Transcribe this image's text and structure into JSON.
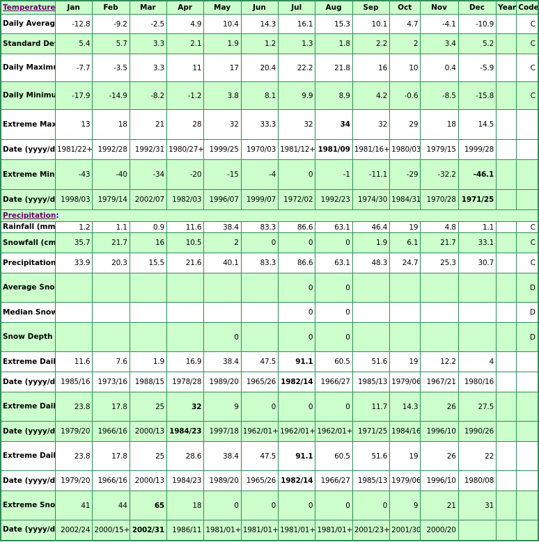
{
  "header": {
    "temperature_label": "Temperature",
    "months": [
      "Jan",
      "Feb",
      "Mar",
      "Apr",
      "May",
      "Jun",
      "Jul",
      "Aug",
      "Sep",
      "Oct",
      "Nov",
      "Dec"
    ],
    "year_label": "Year",
    "code_label": "Code"
  },
  "precipitation_label": "Precipitation",
  "colon": ":",
  "temperature_rows": [
    {
      "label": "Daily Average (°C)",
      "style": "white",
      "values": [
        "-12.8",
        "-9.2",
        "-2.5",
        "4.9",
        "10.4",
        "14.3",
        "16.1",
        "15.3",
        "10.1",
        "4.7",
        "-4.1",
        "-10.9"
      ],
      "year": "",
      "code": "C"
    },
    {
      "label": "Standard Deviation",
      "style": "green",
      "values": [
        "5.4",
        "5.7",
        "3.3",
        "2.1",
        "1.9",
        "1.2",
        "1.3",
        "1.8",
        "2.2",
        "2",
        "3.4",
        "5.2"
      ],
      "year": "",
      "code": "C"
    },
    {
      "label": "Daily Maximum (°C)",
      "style": "white",
      "values": [
        "-7.7",
        "-3.5",
        "3.3",
        "11",
        "17",
        "20.4",
        "22.2",
        "21.8",
        "16",
        "10",
        "0.4",
        "-5.9"
      ],
      "year": "",
      "code": "C"
    },
    {
      "label": "Daily Minimum (°C)",
      "style": "green",
      "values": [
        "-17.9",
        "-14.9",
        "-8.2",
        "-1.2",
        "3.8",
        "8.1",
        "9.9",
        "8.9",
        "4.2",
        "-0.6",
        "-8.5",
        "-15.8"
      ],
      "year": "",
      "code": "C"
    },
    {
      "label": "Extreme Maximum (°C)",
      "style": "white",
      "group_top": true,
      "values": [
        "13",
        "18",
        "21",
        "28",
        "32",
        "33.3",
        "32",
        "34",
        "32",
        "29",
        "18",
        "14.5"
      ],
      "bold_index": 7,
      "year": "",
      "code": ""
    },
    {
      "label": "Date (yyyy/dd)",
      "style": "white",
      "values": [
        "1981/22+",
        "1992/28",
        "1992/31",
        "1980/27+",
        "1999/25",
        "1970/03",
        "1981/12+",
        "1981/09",
        "1981/16+",
        "1980/03",
        "1979/15",
        "1999/28"
      ],
      "bold_index": 7,
      "year": "",
      "code": ""
    },
    {
      "label": "Extreme Minimum (°C)",
      "style": "green",
      "values": [
        "-43",
        "-40",
        "-34",
        "-20",
        "-15",
        "-4",
        "0",
        "-1",
        "-11.1",
        "-29",
        "-32.2",
        "-46.1"
      ],
      "bold_index": 11,
      "year": "",
      "code": ""
    },
    {
      "label": "Date (yyyy/dd)",
      "style": "green",
      "values": [
        "1998/03",
        "1979/14",
        "2002/07",
        "1982/03",
        "1996/07",
        "1999/07",
        "1972/02",
        "1992/23",
        "1974/30",
        "1984/31",
        "1970/28",
        "1971/25"
      ],
      "bold_index": 11,
      "year": "",
      "code": ""
    }
  ],
  "precipitation_rows": [
    {
      "label": "Rainfall (mm)",
      "style": "white",
      "values": [
        "1.2",
        "1.1",
        "0.9",
        "11.6",
        "38.4",
        "83.3",
        "86.6",
        "63.1",
        "46.4",
        "19",
        "4.8",
        "1.1"
      ],
      "year": "",
      "code": "C"
    },
    {
      "label": "Snowfall (cm)",
      "style": "green",
      "values": [
        "35.7",
        "21.7",
        "16",
        "10.5",
        "2",
        "0",
        "0",
        "0",
        "1.9",
        "6.1",
        "21.7",
        "33.1"
      ],
      "year": "",
      "code": "C"
    },
    {
      "label": "Precipitation (mm)",
      "style": "white",
      "values": [
        "33.9",
        "20.3",
        "15.5",
        "21.6",
        "40.1",
        "83.3",
        "86.6",
        "63.1",
        "48.3",
        "24.7",
        "25.3",
        "30.7"
      ],
      "year": "",
      "code": "C"
    },
    {
      "label": "Average Snow Depth (cm)",
      "style": "green",
      "values": [
        "",
        "",
        "",
        "",
        "",
        "",
        "0",
        "0",
        "",
        "",
        "",
        ""
      ],
      "year": "",
      "code": "D"
    },
    {
      "label": "Median Snow Depth (cm)",
      "style": "white",
      "values": [
        "",
        "",
        "",
        "",
        "",
        "",
        "0",
        "0",
        "",
        "",
        "",
        ""
      ],
      "year": "",
      "code": "D"
    },
    {
      "label": "Snow Depth at Month-end (cm)",
      "style": "green",
      "values": [
        "",
        "",
        "",
        "",
        "0",
        "",
        "0",
        "0",
        "",
        "",
        "",
        ""
      ],
      "year": "",
      "code": "D"
    },
    {
      "label": "Extreme Daily Rainfall (mm)",
      "style": "white",
      "group_top": true,
      "values": [
        "11.6",
        "7.6",
        "1.9",
        "16.9",
        "38.4",
        "47.5",
        "91.1",
        "60.5",
        "51.6",
        "19",
        "12.2",
        "4"
      ],
      "bold_index": 6,
      "year": "",
      "code": ""
    },
    {
      "label": "Date (yyyy/dd)",
      "style": "white",
      "values": [
        "1985/16",
        "1973/16",
        "1988/15",
        "1978/28",
        "1989/20",
        "1965/26",
        "1982/14",
        "1966/27",
        "1985/13",
        "1979/06",
        "1967/21",
        "1980/16"
      ],
      "bold_index": 6,
      "year": "",
      "code": ""
    },
    {
      "label": "Extreme Daily Snowfall (cm)",
      "style": "green",
      "values": [
        "23.8",
        "17.8",
        "25",
        "32",
        "9",
        "0",
        "0",
        "0",
        "11.7",
        "14.3",
        "26",
        "27.5"
      ],
      "bold_index": 3,
      "year": "",
      "code": ""
    },
    {
      "label": "Date (yyyy/dd)",
      "style": "green",
      "values": [
        "1979/20",
        "1966/16",
        "2000/13",
        "1984/23",
        "1997/18",
        "1962/01+",
        "1962/01+",
        "1962/01+",
        "1971/25",
        "1984/16",
        "1996/10",
        "1990/26"
      ],
      "bold_index": 3,
      "year": "",
      "code": ""
    },
    {
      "label": "Extreme Daily Precipitation (mm)",
      "style": "white",
      "values": [
        "23.8",
        "17.8",
        "25",
        "28.6",
        "38.4",
        "47.5",
        "91.1",
        "60.5",
        "51.6",
        "19",
        "26",
        "22"
      ],
      "bold_index": 6,
      "year": "",
      "code": ""
    },
    {
      "label": "Date (yyyy/dd)",
      "style": "white",
      "values": [
        "1979/20",
        "1966/16",
        "2000/13",
        "1984/23",
        "1989/20",
        "1965/26",
        "1982/14",
        "1966/27",
        "1985/13",
        "1979/06",
        "1996/10",
        "1980/08"
      ],
      "bold_index": 6,
      "year": "",
      "code": ""
    },
    {
      "label": "Extreme Snow Depth (cm)",
      "style": "green",
      "values": [
        "41",
        "44",
        "65",
        "18",
        "0",
        "0",
        "0",
        "0",
        "0",
        "9",
        "21",
        "31"
      ],
      "bold_index": 2,
      "year": "",
      "code": ""
    },
    {
      "label": "Date (yyyy/dd)",
      "style": "green",
      "values": [
        "2002/24",
        "2000/15+",
        "2002/31",
        "1986/11",
        "1981/01+",
        "1981/01+",
        "1981/01+",
        "1981/01+",
        "2001/23+",
        "2001/30",
        "2000/20"
      ],
      "bold_index": 2,
      "year": "",
      "code": ""
    }
  ]
}
